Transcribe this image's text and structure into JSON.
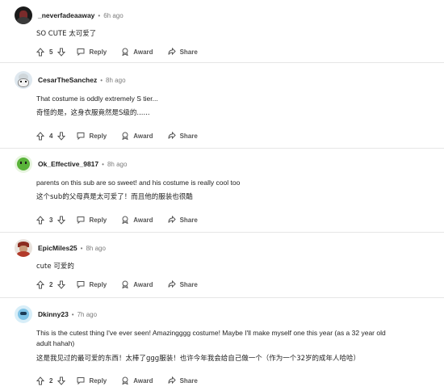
{
  "comments": [
    {
      "username": "_neverfadeaaway",
      "time": "6h ago",
      "lines": [
        "SO CUTE  太可爱了"
      ],
      "votes": "5",
      "reply": "Reply",
      "award": "Award",
      "share": "Share"
    },
    {
      "username": "CesarTheSanchez",
      "time": "8h ago",
      "lines": [
        "That costume is oddly extremely S tier...",
        "奇怪的是，这身衣服竟然是S级的......"
      ],
      "votes": "4",
      "reply": "Reply",
      "award": "Award",
      "share": "Share"
    },
    {
      "username": "Ok_Effective_9817",
      "time": "8h ago",
      "lines": [
        "parents on this sub are so sweet! and his costume is really cool too",
        "这个sub的父母真是太可爱了！而且他的服装也很酷"
      ],
      "votes": "3",
      "reply": "Reply",
      "award": "Award",
      "share": "Share"
    },
    {
      "username": "EpicMiles25",
      "time": "8h ago",
      "lines": [
        "cute  可爱的"
      ],
      "votes": "2",
      "reply": "Reply",
      "award": "Award",
      "share": "Share"
    },
    {
      "username": "Dkinny23",
      "time": "7h ago",
      "lines": [
        "This is the cutest thing I've ever seen! Amazingggg costume! Maybe I'll make myself one this year (as a 32 year old",
        "adult hahah)",
        "这是我见过的最可爱的东西！太棒了ggg服装！也许今年我会给自己做一个（作为一个32岁的成年人哈哈）"
      ],
      "votes": "2",
      "reply": "Reply",
      "award": "Award",
      "share": "Share"
    }
  ],
  "colors": {
    "accent": "#0079d3",
    "muted": "#7c7c7c",
    "text": "#1a1a1b"
  }
}
